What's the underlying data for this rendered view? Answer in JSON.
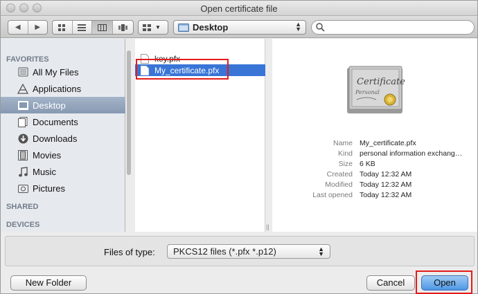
{
  "window": {
    "title": "Open certificate file"
  },
  "toolbar": {
    "location": "Desktop",
    "search_placeholder": ""
  },
  "sidebar": {
    "favorites_heading": "FAVORITES",
    "items": [
      {
        "label": "All My Files",
        "icon": "all-files-icon"
      },
      {
        "label": "Applications",
        "icon": "applications-icon"
      },
      {
        "label": "Desktop",
        "icon": "desktop-icon",
        "selected": true
      },
      {
        "label": "Documents",
        "icon": "documents-icon"
      },
      {
        "label": "Downloads",
        "icon": "downloads-icon"
      },
      {
        "label": "Movies",
        "icon": "movies-icon"
      },
      {
        "label": "Music",
        "icon": "music-icon"
      },
      {
        "label": "Pictures",
        "icon": "pictures-icon"
      }
    ],
    "shared_heading": "SHARED",
    "devices_heading": "DEVICES"
  },
  "files": [
    {
      "name": "key.pfx"
    },
    {
      "name": "My_certificate.pfx",
      "selected": true
    }
  ],
  "preview": {
    "certificate_title": "Certificate",
    "certificate_subtitle": "Personal",
    "info": [
      {
        "key": "Name",
        "value": "My_certificate.pfx"
      },
      {
        "key": "Kind",
        "value": "personal information exchang…"
      },
      {
        "key": "Size",
        "value": "6 KB"
      },
      {
        "key": "Created",
        "value": "Today 12:32 AM"
      },
      {
        "key": "Modified",
        "value": "Today 12:32 AM"
      },
      {
        "key": "Last opened",
        "value": "Today 12:32 AM"
      }
    ]
  },
  "accessory": {
    "files_of_type_label": "Files of type:",
    "files_of_type_value": "PKCS12 files (*.pfx *.p12)"
  },
  "buttons": {
    "new_folder": "New Folder",
    "cancel": "Cancel",
    "open": "Open"
  },
  "colors": {
    "selection_blue": "#3875d7",
    "sidebar_selected": "#8799b2",
    "highlight_red": "#e31b1b"
  }
}
